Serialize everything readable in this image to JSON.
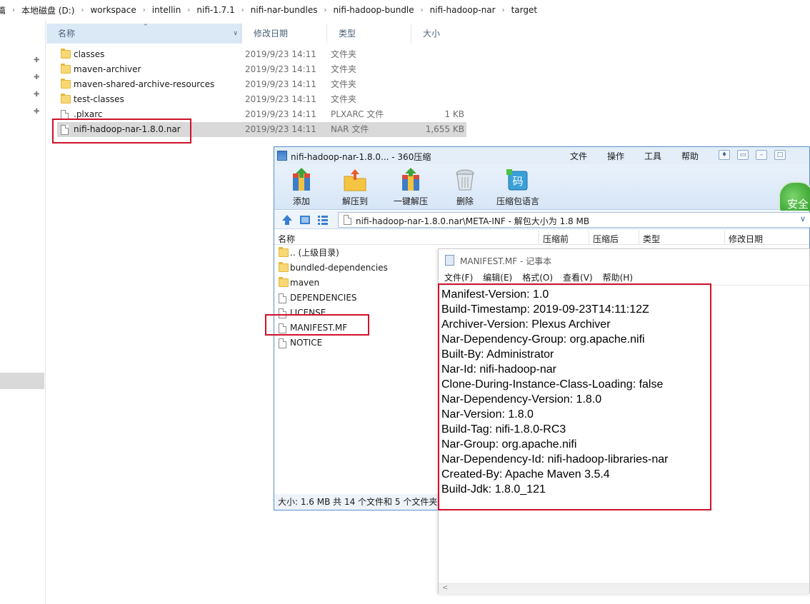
{
  "breadcrumb": [
    "篇",
    "本地磁盘 (D:)",
    "workspace",
    "intellin",
    "nifi-1.7.1",
    "nifi-nar-bundles",
    "nifi-hadoop-bundle",
    "nifi-hadoop-nar",
    "target"
  ],
  "explorer": {
    "columns": {
      "name": "名称",
      "date": "修改日期",
      "type": "类型",
      "size": "大小"
    },
    "files": [
      {
        "name": "classes",
        "date": "2019/9/23 14:11",
        "type": "文件夹",
        "size": "",
        "kind": "folder"
      },
      {
        "name": "maven-archiver",
        "date": "2019/9/23 14:11",
        "type": "文件夹",
        "size": "",
        "kind": "folder"
      },
      {
        "name": "maven-shared-archive-resources",
        "date": "2019/9/23 14:11",
        "type": "文件夹",
        "size": "",
        "kind": "folder"
      },
      {
        "name": "test-classes",
        "date": "2019/9/23 14:11",
        "type": "文件夹",
        "size": "",
        "kind": "folder"
      },
      {
        "name": ".plxarc",
        "date": "2019/9/23 14:11",
        "type": "PLXARC 文件",
        "size": "1 KB",
        "kind": "file"
      },
      {
        "name": "nifi-hadoop-nar-1.8.0.nar",
        "date": "2019/9/23 14:11",
        "type": "NAR 文件",
        "size": "1,655 KB",
        "kind": "file"
      }
    ]
  },
  "zip": {
    "title": "nifi-hadoop-nar-1.8.0... - 360压缩",
    "menu": [
      "文件",
      "操作",
      "工具",
      "帮助"
    ],
    "toolbar": [
      "添加",
      "解压到",
      "一键解压",
      "删除",
      "压缩包语言"
    ],
    "badge": "安全",
    "address": "nifi-hadoop-nar-1.8.0.nar\\META-INF - 解包大小为 1.8 MB",
    "columns": {
      "name": "名称",
      "packed": "压缩前",
      "compressed": "压缩后",
      "type": "类型",
      "modified": "修改日期"
    },
    "items": [
      {
        "name": ".. (上级目录)",
        "kind": "folder"
      },
      {
        "name": "bundled-dependencies",
        "kind": "folder"
      },
      {
        "name": "maven",
        "kind": "folder"
      },
      {
        "name": "DEPENDENCIES",
        "kind": "file"
      },
      {
        "name": "LICENSE",
        "kind": "file"
      },
      {
        "name": "MANIFEST.MF",
        "kind": "file"
      },
      {
        "name": "NOTICE",
        "kind": "file"
      }
    ],
    "status": "大小: 1.6 MB 共 14 个文件和 5 个文件夹"
  },
  "notepad": {
    "title": "MANIFEST.MF - 记事本",
    "menu": [
      "文件(F)",
      "编辑(E)",
      "格式(O)",
      "查看(V)",
      "帮助(H)"
    ],
    "lines": [
      "Manifest-Version: 1.0",
      "Build-Timestamp: 2019-09-23T14:11:12Z",
      "Archiver-Version: Plexus Archiver",
      "Nar-Dependency-Group: org.apache.nifi",
      "Built-By: Administrator",
      "Nar-Id: nifi-hadoop-nar",
      "Clone-During-Instance-Class-Loading: false",
      "Nar-Dependency-Version: 1.8.0",
      "Nar-Version: 1.8.0",
      "Build-Tag: nifi-1.8.0-RC3",
      "Nar-Group: org.apache.nifi",
      "Nar-Dependency-Id: nifi-hadoop-libraries-nar",
      "Created-By: Apache Maven 3.5.4",
      "Build-Jdk: 1.8.0_121"
    ]
  },
  "colors": {
    "highlight_box": "#d0112b",
    "selection": "#d9d9d9",
    "zip_frame": "#5b8fc9"
  }
}
